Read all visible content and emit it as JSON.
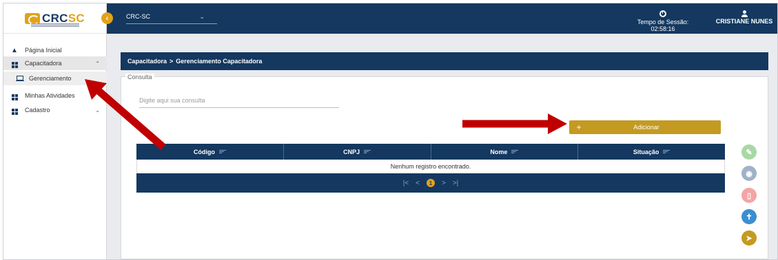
{
  "sidebar": {
    "logo_text_main": "CRC",
    "logo_text_accent": "SC",
    "items": [
      {
        "label": "Página Inicial",
        "icon": "home-icon"
      },
      {
        "label": "Capacitadora",
        "icon": "grid-icon",
        "expanded": true
      },
      {
        "label": "Gerenciamento",
        "icon": "laptop-icon",
        "selected": true
      },
      {
        "label": "Minhas Atividades",
        "icon": "grid-icon"
      },
      {
        "label": "Cadastro",
        "icon": "grid-icon"
      }
    ]
  },
  "header": {
    "org_select_value": "CRC-SC",
    "session_label": "Tempo de Sessão: 02:58:16",
    "user_name": "CRISTIANE NUNES"
  },
  "breadcrumb": {
    "parent": "Capacitadora",
    "separator": ">",
    "current": "Gerenciamento Capacitadora"
  },
  "consulta": {
    "legend": "Consulta",
    "search_placeholder": "Digite aqui sua consulta"
  },
  "actions": {
    "add_icon": "+",
    "add_label": "Adicionar"
  },
  "table": {
    "columns": [
      "Código",
      "CNPJ",
      "Nome",
      "Situação"
    ],
    "empty_message": "Nenhum registro encontrado.",
    "pager": {
      "first": "|<",
      "prev": "<",
      "current_page": "1",
      "next": ">",
      "last": ">|"
    }
  },
  "fabs": [
    {
      "name": "edit",
      "icon": "pencil-icon",
      "color": "#a9d8a4"
    },
    {
      "name": "view",
      "icon": "eye-icon",
      "color": "#9fb2c8"
    },
    {
      "name": "delete",
      "icon": "trash-icon",
      "color": "#f3a5a5"
    },
    {
      "name": "accessibility",
      "icon": "person-icon",
      "color": "#3b8fd0"
    },
    {
      "name": "send",
      "icon": "send-icon",
      "color": "#c49a21"
    }
  ],
  "colors": {
    "navy": "#14385f",
    "gold": "#c49a21",
    "annotation_arrow": "#c00000"
  }
}
